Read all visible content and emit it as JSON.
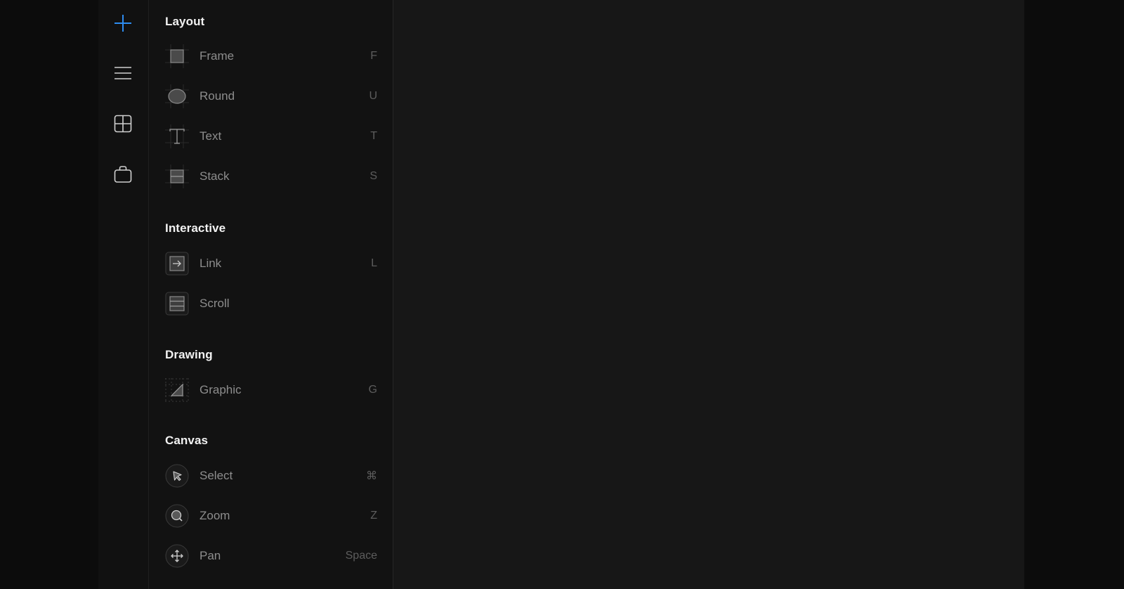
{
  "colors": {
    "accent": "#2e8cf0",
    "panel_bg": "#121212",
    "canvas_bg": "#171717",
    "section_title": "#f2f2f2",
    "tool_label": "#8d8d8d",
    "shortcut_key": "#5d5d5d"
  },
  "rail": {
    "items": [
      {
        "icon": "plus-icon",
        "active": true
      },
      {
        "icon": "menu-icon",
        "active": false
      },
      {
        "icon": "grid-icon",
        "active": false
      },
      {
        "icon": "bag-icon",
        "active": false
      }
    ]
  },
  "panel": {
    "sections": {
      "layout": {
        "title": "Layout",
        "items": [
          {
            "label": "Frame",
            "key": "F",
            "icon": "frame-icon"
          },
          {
            "label": "Round",
            "key": "U",
            "icon": "round-icon"
          },
          {
            "label": "Text",
            "key": "T",
            "icon": "text-icon"
          },
          {
            "label": "Stack",
            "key": "S",
            "icon": "stack-icon"
          }
        ]
      },
      "interactive": {
        "title": "Interactive",
        "items": [
          {
            "label": "Link",
            "key": "L",
            "icon": "link-icon"
          },
          {
            "label": "Scroll",
            "key": "",
            "icon": "scroll-icon"
          }
        ]
      },
      "drawing": {
        "title": "Drawing",
        "items": [
          {
            "label": "Graphic",
            "key": "G",
            "icon": "graphic-icon"
          }
        ]
      },
      "canvas": {
        "title": "Canvas",
        "items": [
          {
            "label": "Select",
            "key": "⌘",
            "icon": "cursor-icon"
          },
          {
            "label": "Zoom",
            "key": "Z",
            "icon": "zoom-icon"
          },
          {
            "label": "Pan",
            "key": "Space",
            "icon": "move-icon"
          }
        ]
      }
    }
  }
}
